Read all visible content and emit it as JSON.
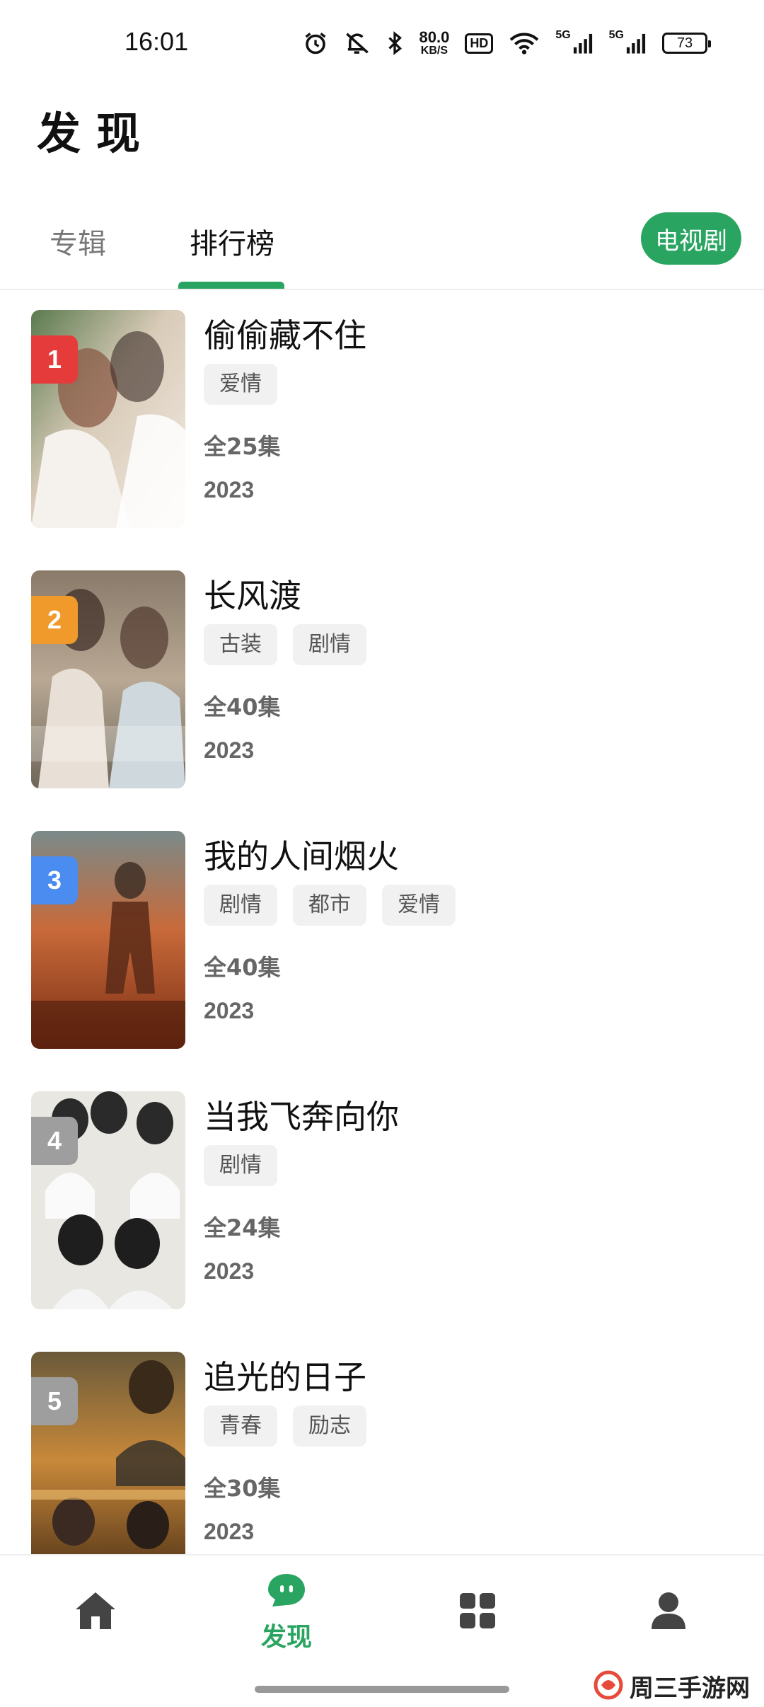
{
  "status_bar": {
    "time": "16:01",
    "net_speed_value": "80.0",
    "net_speed_unit": "KB/S",
    "hd_label": "HD",
    "signal_1": "5G",
    "signal_2": "5G",
    "battery": "73",
    "icons": [
      "alarm-icon",
      "mute-icon",
      "bluetooth-icon",
      "hd-icon",
      "wifi-icon",
      "signal-icon",
      "signal-icon",
      "battery-icon"
    ]
  },
  "header": {
    "title": "发现"
  },
  "tabs": [
    {
      "label": "专辑",
      "active": false
    },
    {
      "label": "排行榜",
      "active": true
    }
  ],
  "category_button": "电视剧",
  "rankings": [
    {
      "rank": "1",
      "rank_color": "#e63b3b",
      "title": "偷偷藏不住",
      "tags": [
        "爱情"
      ],
      "episodes": "全25集",
      "year": "2023"
    },
    {
      "rank": "2",
      "rank_color": "#ef9a2a",
      "title": "长风渡",
      "tags": [
        "古装",
        "剧情"
      ],
      "episodes": "全40集",
      "year": "2023"
    },
    {
      "rank": "3",
      "rank_color": "#4a8cf0",
      "title": "我的人间烟火",
      "tags": [
        "剧情",
        "都市",
        "爱情"
      ],
      "episodes": "全40集",
      "year": "2023"
    },
    {
      "rank": "4",
      "rank_color": "#9e9e9e",
      "title": "当我飞奔向你",
      "tags": [
        "剧情"
      ],
      "episodes": "全24集",
      "year": "2023"
    },
    {
      "rank": "5",
      "rank_color": "#9e9e9e",
      "title": "追光的日子",
      "tags": [
        "青春",
        "励志"
      ],
      "episodes": "全30集",
      "year": "2023"
    }
  ],
  "bottom_nav": {
    "items": [
      {
        "icon": "home-icon",
        "label": ""
      },
      {
        "icon": "discover-icon",
        "label": "发现",
        "active": true
      },
      {
        "icon": "grid-icon",
        "label": ""
      },
      {
        "icon": "user-icon",
        "label": ""
      }
    ]
  },
  "watermark": "周三手游网",
  "colors": {
    "accent": "#2aa561",
    "nav_icon": "#444444"
  }
}
